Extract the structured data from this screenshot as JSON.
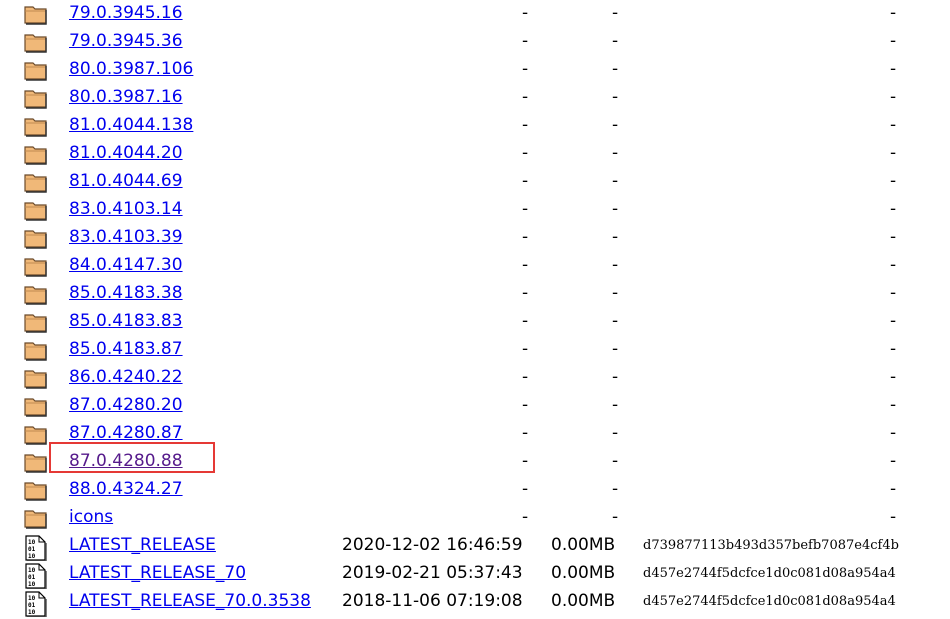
{
  "colors": {
    "link": "#0000ee",
    "visited": "#551a8b",
    "highlight": "#e53935",
    "folder": "#f0b878"
  },
  "highlighted_entry": "87.0.4280.88",
  "entries": [
    {
      "type": "folder",
      "name": "79.0.3945.16",
      "date": "-",
      "size": "-",
      "hash": "-"
    },
    {
      "type": "folder",
      "name": "79.0.3945.36",
      "date": "-",
      "size": "-",
      "hash": "-"
    },
    {
      "type": "folder",
      "name": "80.0.3987.106",
      "date": "-",
      "size": "-",
      "hash": "-"
    },
    {
      "type": "folder",
      "name": "80.0.3987.16",
      "date": "-",
      "size": "-",
      "hash": "-"
    },
    {
      "type": "folder",
      "name": "81.0.4044.138",
      "date": "-",
      "size": "-",
      "hash": "-"
    },
    {
      "type": "folder",
      "name": "81.0.4044.20",
      "date": "-",
      "size": "-",
      "hash": "-"
    },
    {
      "type": "folder",
      "name": "81.0.4044.69",
      "date": "-",
      "size": "-",
      "hash": "-"
    },
    {
      "type": "folder",
      "name": "83.0.4103.14",
      "date": "-",
      "size": "-",
      "hash": "-"
    },
    {
      "type": "folder",
      "name": "83.0.4103.39",
      "date": "-",
      "size": "-",
      "hash": "-"
    },
    {
      "type": "folder",
      "name": "84.0.4147.30",
      "date": "-",
      "size": "-",
      "hash": "-"
    },
    {
      "type": "folder",
      "name": "85.0.4183.38",
      "date": "-",
      "size": "-",
      "hash": "-"
    },
    {
      "type": "folder",
      "name": "85.0.4183.83",
      "date": "-",
      "size": "-",
      "hash": "-"
    },
    {
      "type": "folder",
      "name": "85.0.4183.87",
      "date": "-",
      "size": "-",
      "hash": "-"
    },
    {
      "type": "folder",
      "name": "86.0.4240.22",
      "date": "-",
      "size": "-",
      "hash": "-"
    },
    {
      "type": "folder",
      "name": "87.0.4280.20",
      "date": "-",
      "size": "-",
      "hash": "-"
    },
    {
      "type": "folder",
      "name": "87.0.4280.87",
      "date": "-",
      "size": "-",
      "hash": "-"
    },
    {
      "type": "folder",
      "name": "87.0.4280.88",
      "date": "-",
      "size": "-",
      "hash": "-",
      "visited": true
    },
    {
      "type": "folder",
      "name": "88.0.4324.27",
      "date": "-",
      "size": "-",
      "hash": "-"
    },
    {
      "type": "folder",
      "name": "icons",
      "date": "-",
      "size": "-",
      "hash": "-"
    },
    {
      "type": "file",
      "name": "LATEST_RELEASE",
      "date": "2020-12-02 16:46:59",
      "size": "0.00MB",
      "hash": "d739877113b493d357befb7087e4cf4b"
    },
    {
      "type": "file",
      "name": "LATEST_RELEASE_70",
      "date": "2019-02-21 05:37:43",
      "size": "0.00MB",
      "hash": "d457e2744f5dcfce1d0c081d08a954a4"
    },
    {
      "type": "file",
      "name": "LATEST_RELEASE_70.0.3538",
      "date": "2018-11-06 07:19:08",
      "size": "0.00MB",
      "hash": "d457e2744f5dcfce1d0c081d08a954a4"
    },
    {
      "type": "file",
      "name": "",
      "date": "",
      "size": "",
      "hash": ""
    }
  ]
}
